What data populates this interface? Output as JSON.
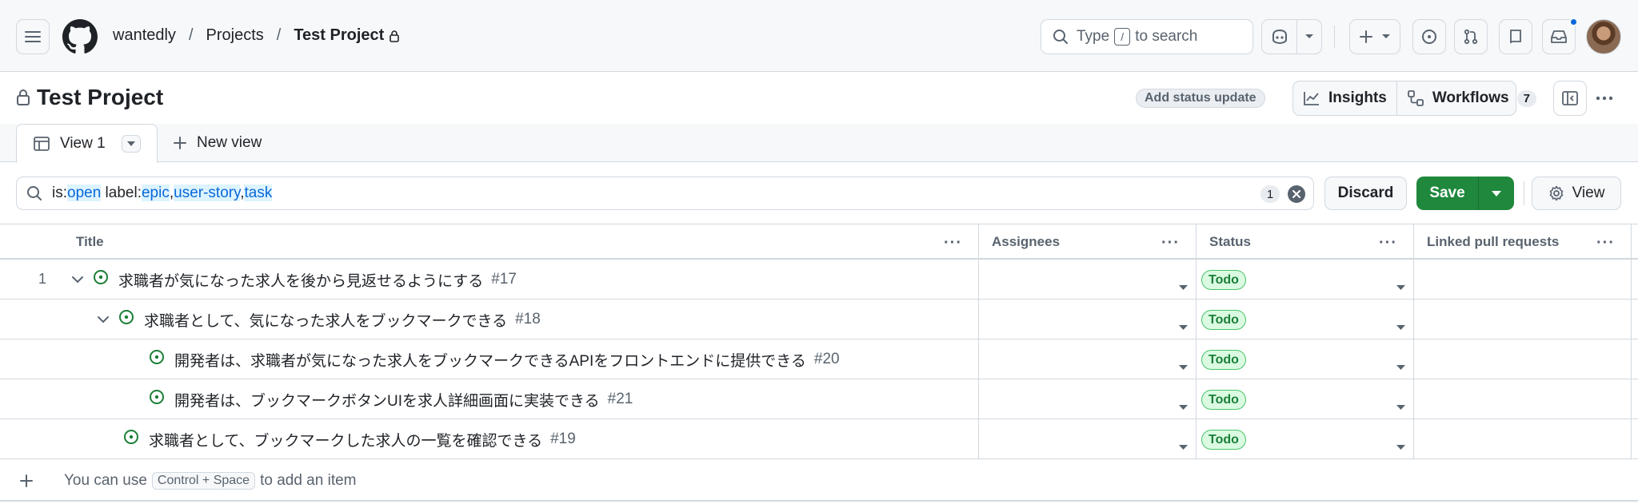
{
  "header": {
    "breadcrumbs": [
      "wantedly",
      "Projects",
      "Test Project"
    ],
    "search": {
      "prefix": "Type",
      "key": "/",
      "suffix": "to search"
    }
  },
  "project": {
    "title": "Test Project",
    "status_update_label": "Add status update",
    "insights_label": "Insights",
    "workflows_label": "Workflows",
    "workflows_count": "7"
  },
  "tabs": [
    {
      "label": "View 1",
      "active": true
    }
  ],
  "new_view_label": "New view",
  "filter": {
    "parts": [
      {
        "text": "is:",
        "hl": false
      },
      {
        "text": "open",
        "hl": true
      },
      {
        "text": " label:",
        "hl": false
      },
      {
        "text": "epic",
        "hl": true
      },
      {
        "text": ",",
        "hl": false
      },
      {
        "text": "user-story",
        "hl": true
      },
      {
        "text": ",",
        "hl": false
      },
      {
        "text": "task",
        "hl": true
      }
    ],
    "count": "1"
  },
  "actions": {
    "discard": "Discard",
    "save": "Save",
    "view": "View"
  },
  "table": {
    "columns": [
      "Title",
      "Assignees",
      "Status",
      "Linked pull requests"
    ],
    "rows": [
      {
        "num": "1",
        "level": 0,
        "expandable": true,
        "title": "求職者が気になった求人を後から見返せるようにする",
        "issue": "#17",
        "status": "Todo"
      },
      {
        "num": "",
        "level": 1,
        "expandable": true,
        "title": "求職者として、気になった求人をブックマークできる",
        "issue": "#18",
        "status": "Todo"
      },
      {
        "num": "",
        "level": 2,
        "expandable": false,
        "title": "開発者は、求職者が気になった求人をブックマークできるAPIをフロントエンドに提供できる",
        "issue": "#20",
        "status": "Todo"
      },
      {
        "num": "",
        "level": 2,
        "expandable": false,
        "title": "開発者は、ブックマークボタンUIを求人詳細画面に実装できる",
        "issue": "#21",
        "status": "Todo"
      },
      {
        "num": "",
        "level": 1,
        "expandable": false,
        "title": "求職者として、ブックマークした求人の一覧を確認できる",
        "issue": "#19",
        "status": "Todo"
      }
    ],
    "footer": {
      "prefix": "You can use",
      "shortcut": "Control + Space",
      "suffix": "to add an item"
    }
  },
  "colors": {
    "green": "#1f883d",
    "todo_text": "#1a7f37",
    "todo_bg": "#dafbe1",
    "link_blue": "#0969da",
    "border": "#d1d9e0"
  }
}
